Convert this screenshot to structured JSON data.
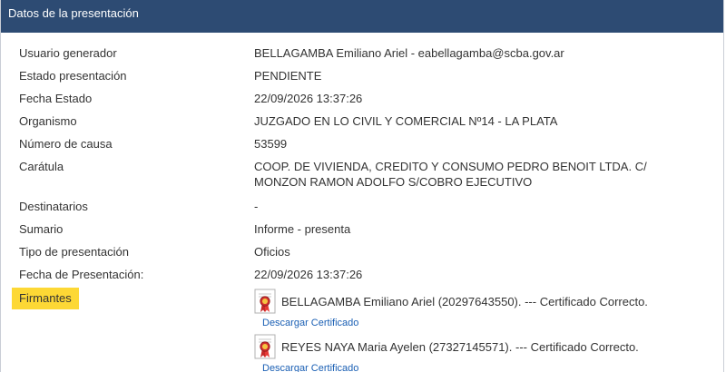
{
  "header": {
    "title": "Datos de la presentación"
  },
  "fields": [
    {
      "label": "Usuario generador",
      "value": "BELLAGAMBA Emiliano Ariel - eabellagamba@scba.gov.ar"
    },
    {
      "label": "Estado presentación",
      "value": "PENDIENTE"
    },
    {
      "label": "Fecha Estado",
      "value": "22/09/2026 13:37:26"
    },
    {
      "label": "Organismo",
      "value": "JUZGADO EN LO CIVIL Y COMERCIAL Nº14 - LA PLATA"
    },
    {
      "label": "Número de causa",
      "value": "53599"
    },
    {
      "label": "Carátula",
      "value": "COOP. DE VIVIENDA, CREDITO Y CONSUMO PEDRO BENOIT LTDA. C/ MONZON RAMON ADOLFO S/COBRO EJECUTIVO"
    },
    {
      "label": "Destinatarios",
      "value": "-"
    },
    {
      "label": "Sumario",
      "value": "Informe - presenta"
    },
    {
      "label": "Tipo de presentación",
      "value": "Oficios"
    },
    {
      "label": "Fecha de Presentación:",
      "value": "22/09/2026 13:37:26"
    }
  ],
  "firmantes": {
    "label": "Firmantes",
    "signers": [
      {
        "text": "BELLAGAMBA Emiliano Ariel (20297643550). --- Certificado Correcto.",
        "link": "Descargar Certificado"
      },
      {
        "text": "REYES NAYA Maria Ayelen (27327145571). --- Certificado Correcto.",
        "link": "Descargar Certificado"
      }
    ]
  },
  "icons": {
    "certificate": "certificate-ribbon-icon"
  },
  "colors": {
    "header_bg": "#2d4b73",
    "highlight": "#fdd835",
    "link": "#1a5fb4",
    "seal": "#d32f2f"
  }
}
